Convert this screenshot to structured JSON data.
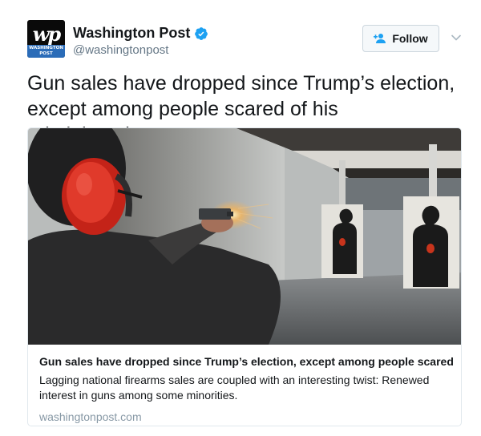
{
  "account": {
    "name": "Washington Post",
    "handle": "@washingtonpost",
    "logo_text": "wp",
    "logo_band_line1": "WASHINGTON",
    "logo_band_line2": "POST",
    "verified": true
  },
  "follow_button": {
    "label": "Follow",
    "icon": "add-user-icon"
  },
  "menu": {
    "icon": "chevron-down-icon"
  },
  "tweet": {
    "text": "Gun sales have dropped since Trump’s election, except among people scared of his administration"
  },
  "card": {
    "image_icon": "shooting-range-photo",
    "title": "Gun sales have dropped since Trump’s election, except among people scared...",
    "description": "Lagging national firearms sales are coupled with an interesting twist: Renewed interest in guns among some minorities.",
    "domain": "washingtonpost.com"
  },
  "colors": {
    "verified_blue": "#1da1f2",
    "text_primary": "#14171a",
    "text_secondary": "#657786",
    "border": "#e1e8ed"
  }
}
